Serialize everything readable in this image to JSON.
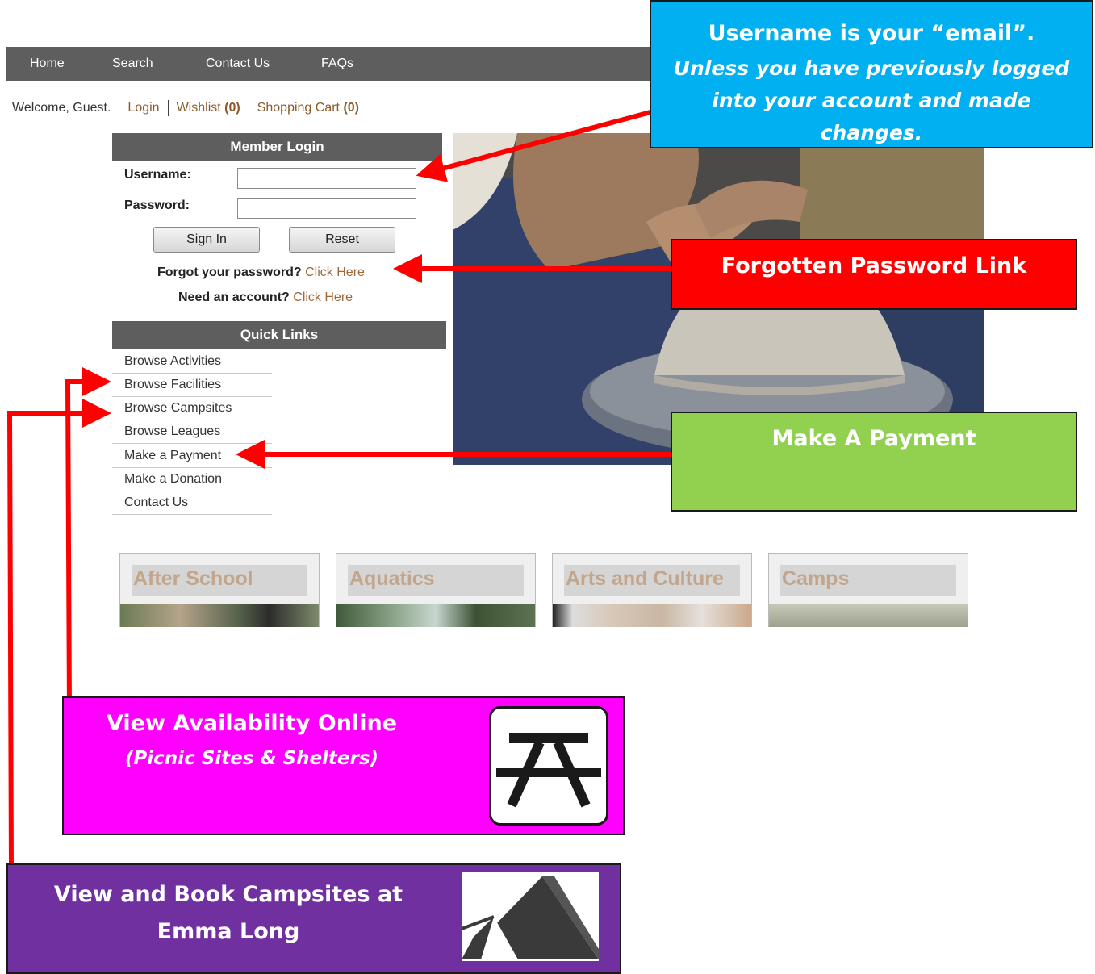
{
  "nav": {
    "items": [
      {
        "label": "Home"
      },
      {
        "label": "Search"
      },
      {
        "label": "Contact Us"
      },
      {
        "label": "FAQs"
      }
    ]
  },
  "welcome": {
    "greeting": "Welcome, Guest.",
    "login": "Login",
    "wishlist": "Wishlist",
    "wishlist_count": "(0)",
    "cart": "Shopping Cart",
    "cart_count": "(0)"
  },
  "login": {
    "title": "Member Login",
    "username_label": "Username:",
    "password_label": "Password:",
    "username_value": "",
    "password_value": "",
    "sign_in": "Sign In",
    "reset": "Reset",
    "forgot_text": "Forgot your password?",
    "forgot_link": "Click Here",
    "account_text": "Need an account?",
    "account_link": "Click Here"
  },
  "quick_links": {
    "title": "Quick Links",
    "items": [
      "Browse Activities",
      "Browse Facilities",
      "Browse Campsites",
      "Browse Leagues",
      "Make a Payment",
      "Make a Donation",
      "Contact Us"
    ]
  },
  "categories": [
    {
      "label": "After School"
    },
    {
      "label": "Aquatics"
    },
    {
      "label": "Arts and Culture"
    },
    {
      "label": "Camps"
    }
  ],
  "callouts": {
    "username": {
      "title": "Username is your “email”.",
      "subtitle": "Unless you have previously logged into your account and made changes.",
      "color": "#00b0f0"
    },
    "forgot": {
      "title": "Forgotten Password Link",
      "color": "#ff0000"
    },
    "payment": {
      "title": "Make A Payment",
      "color": "#92d050"
    },
    "picnic": {
      "title": "View Availability Online",
      "subtitle": "(Picnic Sites & Shelters)",
      "icon": "picnic-table-icon",
      "color": "#ff00ff"
    },
    "campsite": {
      "title": "View and Book Campsites at Emma Long",
      "icon": "tent-icon",
      "color": "#7030a0"
    }
  },
  "colors": {
    "nav_bg": "#5e5e5e",
    "link": "#a0683a",
    "arrow": "#ff0000"
  }
}
